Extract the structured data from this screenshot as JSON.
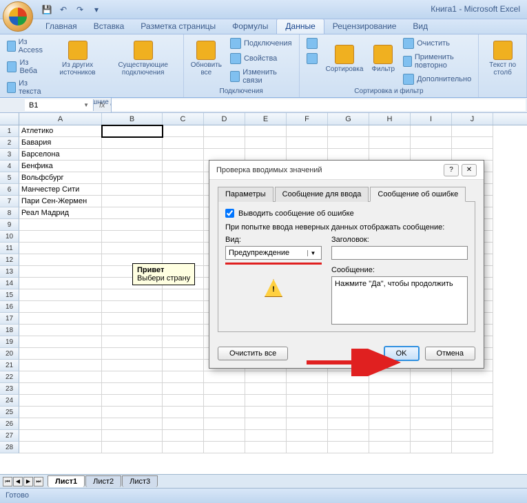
{
  "title": "Книга1  -  Microsoft Excel",
  "tabs": [
    "Главная",
    "Вставка",
    "Разметка страницы",
    "Формулы",
    "Данные",
    "Рецензирование",
    "Вид"
  ],
  "active_tab": 4,
  "ribbon": {
    "g1": {
      "label": "Получить внешние данные",
      "items_small": [
        "Из Access",
        "Из Веба",
        "Из текста"
      ],
      "big1": "Из других источников",
      "big2": "Существующие подключения"
    },
    "g2": {
      "label": "Подключения",
      "big": "Обновить все",
      "items": [
        "Подключения",
        "Свойства",
        "Изменить связи"
      ]
    },
    "g3": {
      "label": "Сортировка и фильтр",
      "sort_az_icon": "A↓Z",
      "sort_za_icon": "Z↓A",
      "sort": "Сортировка",
      "filter": "Фильтр",
      "items": [
        "Очистить",
        "Применить повторно",
        "Дополнительно"
      ]
    },
    "g4": {
      "big": "Текст по столб"
    }
  },
  "namebox": "B1",
  "fx_label": "fx",
  "columns": [
    "A",
    "B",
    "C",
    "D",
    "E",
    "F",
    "G",
    "H",
    "I",
    "J"
  ],
  "col_widths": [
    "cw-a",
    "cw-b",
    "cw-c",
    "cw-d",
    "cw-e",
    "cw-f",
    "cw-g",
    "cw-h",
    "cw-i",
    "cw-j"
  ],
  "row_count": 28,
  "cells_colA": [
    "Атлетико",
    "Бавария",
    "Барселона",
    "Бенфика",
    "Вольфсбург",
    "Манчестер Сити",
    "Пари Сен-Жермен",
    "Реал Мадрид"
  ],
  "active_cell": "B1",
  "tooltip": {
    "title": "Привет",
    "body": "Выбери страну"
  },
  "sheets": [
    "Лист1",
    "Лист2",
    "Лист3"
  ],
  "active_sheet": 0,
  "status": "Готово",
  "dialog": {
    "title": "Проверка вводимых значений",
    "help": "?",
    "close": "✕",
    "tabs": [
      "Параметры",
      "Сообщение для ввода",
      "Сообщение об ошибке"
    ],
    "active_tab": 2,
    "checkbox": "Выводить сообщение об ошибке",
    "intro": "При попытке ввода неверных данных отображать сообщение:",
    "kind_label": "Вид:",
    "kind_value": "Предупреждение",
    "title_label": "Заголовок:",
    "title_value": "",
    "msg_label": "Сообщение:",
    "msg_value": "Нажмите \"Да\", чтобы продолжить",
    "clear": "Очистить все",
    "ok": "OK",
    "cancel": "Отмена"
  }
}
